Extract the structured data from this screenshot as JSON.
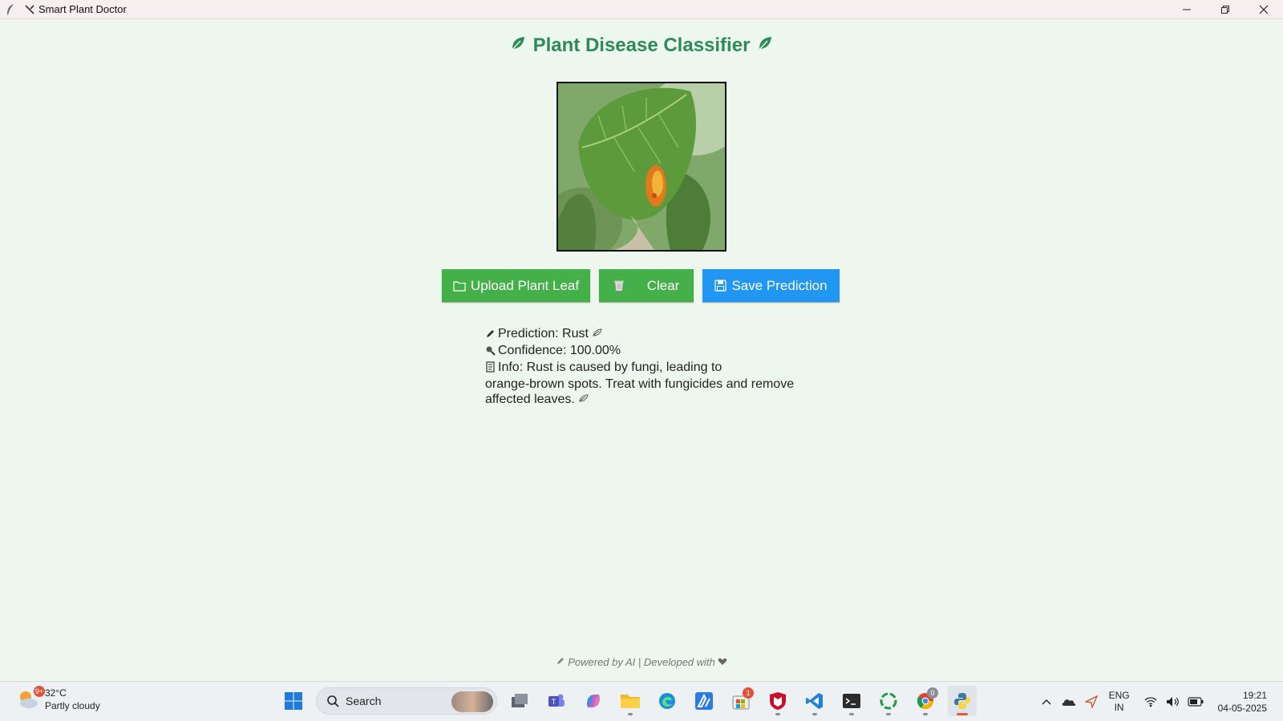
{
  "window": {
    "title": "Smart Plant Doctor",
    "controls": {
      "minimize": "minimize",
      "maximize": "maximize",
      "close": "close"
    }
  },
  "app": {
    "heading": "Plant Disease Classifier",
    "heading_color": "#2e8b57",
    "buttons": {
      "upload_label": "Upload Plant Leaf",
      "clear_label": "Clear",
      "save_label": "Save Prediction"
    },
    "button_colors": {
      "green": "#43b04a",
      "blue": "#2196f3"
    },
    "result": {
      "prediction": "Prediction: Rust",
      "confidence": "Confidence: 100.00%",
      "info": "Info: Rust is caused by fungi, leading to",
      "info_line2": "orange-brown spots. Treat with fungicides and remove",
      "info_line3": "affected leaves."
    },
    "footer": "Powered by AI | Developed with"
  },
  "taskbar": {
    "weather": {
      "temp": "32°C",
      "condition": "Partly cloudy",
      "badge": "9+"
    },
    "search_label": "Search",
    "apps": [
      {
        "name": "start",
        "icon": "windows-logo-icon"
      },
      {
        "name": "task-view",
        "icon": "task-view-icon"
      },
      {
        "name": "teams",
        "icon": "teams-icon"
      },
      {
        "name": "copilot",
        "icon": "copilot-icon"
      },
      {
        "name": "file-explorer",
        "icon": "folder-icon"
      },
      {
        "name": "edge",
        "icon": "edge-icon"
      },
      {
        "name": "store-app",
        "icon": "app-icon"
      },
      {
        "name": "microsoft-store",
        "icon": "store-icon",
        "badge": "1"
      },
      {
        "name": "mcafee",
        "icon": "shield-icon"
      },
      {
        "name": "vscode",
        "icon": "vscode-icon"
      },
      {
        "name": "terminal",
        "icon": "terminal-icon"
      },
      {
        "name": "ring-app",
        "icon": "ring-icon"
      },
      {
        "name": "chrome",
        "icon": "chrome-icon",
        "badge": "0"
      },
      {
        "name": "python",
        "icon": "python-icon"
      }
    ],
    "tray": {
      "lang": "ENG",
      "region": "IN",
      "time": "19:21",
      "date": "04-05-2025"
    }
  }
}
